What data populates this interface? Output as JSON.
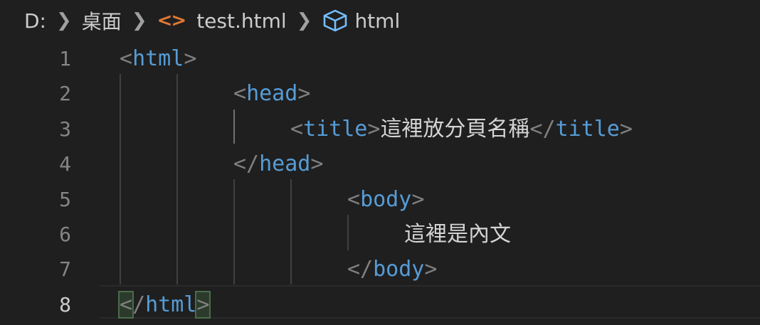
{
  "breadcrumb": {
    "drive": "D:",
    "folder": "桌面",
    "file_icon": "<>",
    "file": "test.html",
    "symbol": "html"
  },
  "lines": [
    {
      "num": "1"
    },
    {
      "num": "2"
    },
    {
      "num": "3"
    },
    {
      "num": "4"
    },
    {
      "num": "5"
    },
    {
      "num": "6"
    },
    {
      "num": "7"
    },
    {
      "num": "8"
    }
  ],
  "code": {
    "html_tag": "html",
    "head_tag": "head",
    "title_tag": "title",
    "title_text": "這裡放分頁名稱",
    "body_tag": "body",
    "body_text": "這裡是內文",
    "lt": "<",
    "gt": ">",
    "close": "</"
  },
  "colors": {
    "background": "#1f1f1f",
    "tag": "#569cd6",
    "punctuation": "#808080",
    "text": "#d4d4d4",
    "line_number": "#858585",
    "file_icon": "#e37933"
  },
  "icons": [
    "chevron-right-icon",
    "html-file-icon",
    "symbol-box-icon"
  ]
}
